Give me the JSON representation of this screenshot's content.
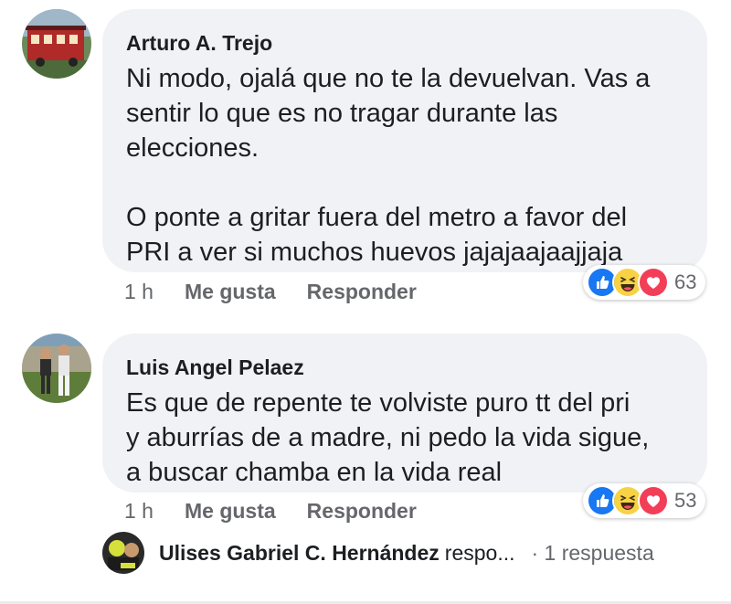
{
  "comments": [
    {
      "author": "Arturo A. Trejo",
      "text": "Ni modo, ojalá que no te la devuelvan. Vas a\nsentir lo que es no tragar durante las\nelecciones.\n\nO ponte a gritar fuera del metro a favor del\nPRI a ver si muchos huevos jajajaajaajjaja",
      "time": "1 h",
      "like_label": "Me gusta",
      "reply_label": "Responder",
      "reaction_count": "63",
      "reaction_icons": [
        "like-icon",
        "haha-icon",
        "love-icon"
      ]
    },
    {
      "author": "Luis Angel Pelaez",
      "text": "Es que de repente te volviste puro tt del pri\ny aburrías de a madre, ni pedo la vida sigue,\na buscar chamba en la vida real",
      "time": "1 h",
      "like_label": "Me gusta",
      "reply_label": "Responder",
      "reaction_count": "53",
      "reaction_icons": [
        "like-icon",
        "haha-icon",
        "love-icon"
      ]
    }
  ],
  "reply_preview": {
    "name": "Ulises Gabriel C. Hernández",
    "verb": "respo...",
    "count": "· 1 respuesta"
  },
  "colors": {
    "bubble": "#f0f2f5",
    "meta_text": "#65676b",
    "like_blue": "#1877f2",
    "haha_yellow": "#f7d245",
    "love_red": "#f33e58"
  }
}
